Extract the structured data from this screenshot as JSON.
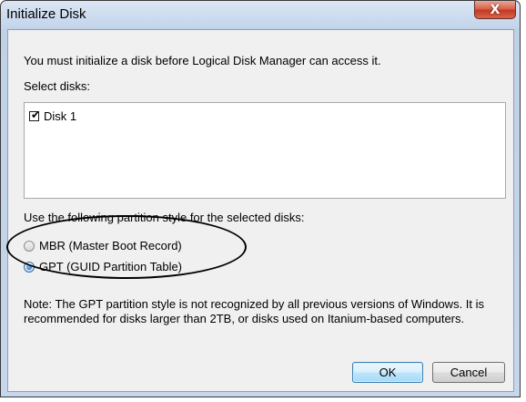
{
  "window": {
    "title": "Initialize Disk",
    "close_label": "X"
  },
  "dialog": {
    "intro_text": "You must initialize a disk before Logical Disk Manager can access it.",
    "select_disks_label": "Select disks:",
    "disks": [
      {
        "label": "Disk 1",
        "checked": true
      }
    ],
    "partition_style_label": "Use the following partition style for the selected disks:",
    "partition_styles": [
      {
        "label": "MBR (Master Boot Record)",
        "selected": false
      },
      {
        "label": "GPT (GUID Partition Table)",
        "selected": true
      }
    ],
    "note_text": "Note: The GPT partition style is not recognized by all previous versions of Windows. It is recommended for disks larger than 2TB, or disks used on Itanium-based computers.",
    "ok_label": "OK",
    "cancel_label": "Cancel"
  }
}
